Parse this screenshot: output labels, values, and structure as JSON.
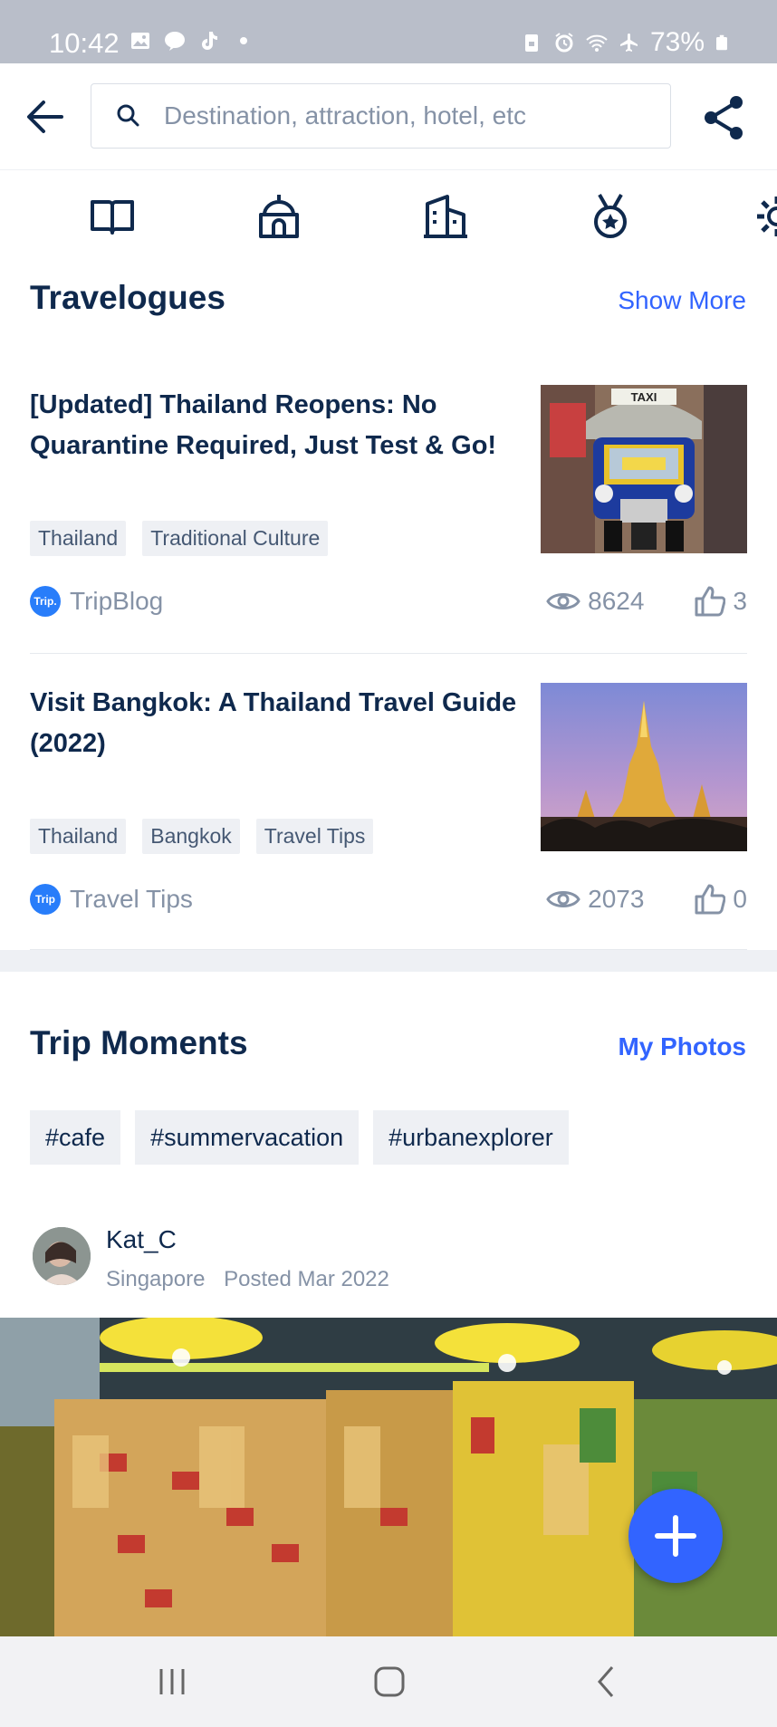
{
  "status_bar": {
    "time": "10:42",
    "battery": "73%",
    "left_icons": [
      "gallery-icon",
      "line-icon",
      "tiktok-icon",
      "dot-icon"
    ],
    "right_icons": [
      "lock-icon",
      "alarm-icon",
      "wifi-icon",
      "airplane-icon",
      "battery-icon"
    ]
  },
  "header": {
    "search_placeholder": "Destination, attraction, hotel, etc"
  },
  "category_icons": [
    "book-icon",
    "temple-icon",
    "building-icon",
    "medal-icon",
    "gear-icon"
  ],
  "travelogues": {
    "title": "Travelogues",
    "show_more": "Show More",
    "items": [
      {
        "title": "[Updated] Thailand Reopens: No Quarantine Required, Just Test & Go!",
        "tags": [
          "Thailand",
          "Traditional Culture"
        ],
        "author_logo": "Trip.",
        "author": "TripBlog",
        "views": "8624",
        "likes": "3"
      },
      {
        "title": "Visit Bangkok: A Thailand Travel Guide (2022)",
        "tags": [
          "Thailand",
          "Bangkok",
          "Travel Tips"
        ],
        "author_logo": "Trip",
        "author": "Travel Tips",
        "views": "2073",
        "likes": "0"
      }
    ]
  },
  "trip_moments": {
    "title": "Trip Moments",
    "my_photos": "My Photos",
    "hashtags": [
      "#cafe",
      "#summervacation",
      "#urbanexplorer"
    ],
    "post": {
      "user": "Kat_C",
      "location": "Singapore",
      "posted": "Posted Mar 2022"
    }
  },
  "colors": {
    "accent": "#3264ff",
    "text": "#0f294d",
    "muted": "#8592a6",
    "tag_bg": "#eef0f4"
  }
}
